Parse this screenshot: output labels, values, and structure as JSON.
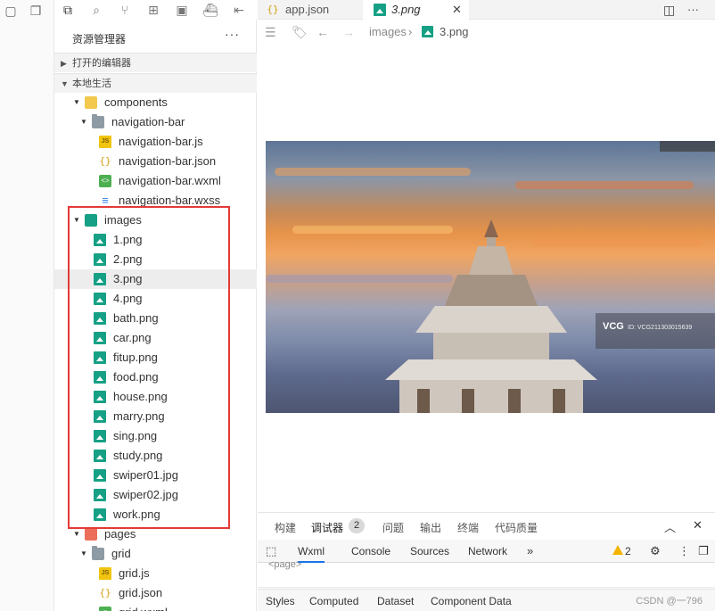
{
  "activity_bar": {
    "icons": [
      "explorer-icon",
      "search-icon",
      "source-control-icon",
      "extensions-icon",
      "storage-icon",
      "docker-icon",
      "debug-icon"
    ]
  },
  "explorer": {
    "title": "资源管理器",
    "more": "···",
    "sections": [
      {
        "label": "打开的编辑器",
        "expanded": false
      },
      {
        "label": "本地生活",
        "expanded": true
      }
    ],
    "tree": [
      {
        "name": "components",
        "kind": "folder-yellow",
        "depth": 1,
        "expanded": true
      },
      {
        "name": "navigation-bar",
        "kind": "folder",
        "depth": 2,
        "expanded": true
      },
      {
        "name": "navigation-bar.js",
        "kind": "js",
        "depth": 3
      },
      {
        "name": "navigation-bar.json",
        "kind": "json",
        "depth": 3
      },
      {
        "name": "navigation-bar.wxml",
        "kind": "wxml",
        "depth": 3
      },
      {
        "name": "navigation-bar.wxss",
        "kind": "wxss",
        "depth": 3
      },
      {
        "name": "images",
        "kind": "folder-teal",
        "depth": 1,
        "expanded": true
      },
      {
        "name": "1.png",
        "kind": "img",
        "depth": 2
      },
      {
        "name": "2.png",
        "kind": "img",
        "depth": 2
      },
      {
        "name": "3.png",
        "kind": "img",
        "depth": 2,
        "selected": true
      },
      {
        "name": "4.png",
        "kind": "img",
        "depth": 2
      },
      {
        "name": "bath.png",
        "kind": "img",
        "depth": 2
      },
      {
        "name": "car.png",
        "kind": "img",
        "depth": 2
      },
      {
        "name": "fitup.png",
        "kind": "img",
        "depth": 2
      },
      {
        "name": "food.png",
        "kind": "img",
        "depth": 2
      },
      {
        "name": "house.png",
        "kind": "img",
        "depth": 2
      },
      {
        "name": "marry.png",
        "kind": "img",
        "depth": 2
      },
      {
        "name": "sing.png",
        "kind": "img",
        "depth": 2
      },
      {
        "name": "study.png",
        "kind": "img",
        "depth": 2
      },
      {
        "name": "swiper01.jpg",
        "kind": "img",
        "depth": 2
      },
      {
        "name": "swiper02.jpg",
        "kind": "img",
        "depth": 2
      },
      {
        "name": "work.png",
        "kind": "img",
        "depth": 2
      },
      {
        "name": "pages",
        "kind": "folder-red",
        "depth": 1,
        "expanded": true
      },
      {
        "name": "grid",
        "kind": "folder",
        "depth": 2,
        "expanded": true
      },
      {
        "name": "grid.js",
        "kind": "js",
        "depth": 3
      },
      {
        "name": "grid.json",
        "kind": "json",
        "depth": 3
      },
      {
        "name": "grid.wxml",
        "kind": "wxml",
        "depth": 3
      }
    ]
  },
  "tabs": [
    {
      "label": "app.json",
      "active": false
    },
    {
      "label": "3.png",
      "active": true
    }
  ],
  "tab_actions": {
    "close": "✕",
    "split": "◫",
    "more": "···"
  },
  "breadcrumb": {
    "folder": "images",
    "separator": "›",
    "file": "3.png"
  },
  "preview": {
    "watermark_logo": "VCG",
    "watermark_id": "ID: VCG211303015639"
  },
  "panel": {
    "tabs": [
      "构建",
      "调试器",
      "问题",
      "输出",
      "终端",
      "代码质量"
    ],
    "active_tab": "调试器",
    "debugger_badge": "2",
    "devtools_tabs": [
      "Wxml",
      "Console",
      "Sources",
      "Network"
    ],
    "devtools_more": "»",
    "warning_count": "2",
    "console_clip": "<page>",
    "style_tabs": [
      "Styles",
      "Computed",
      "Dataset",
      "Component Data"
    ],
    "credit": "CSDN @一796"
  }
}
